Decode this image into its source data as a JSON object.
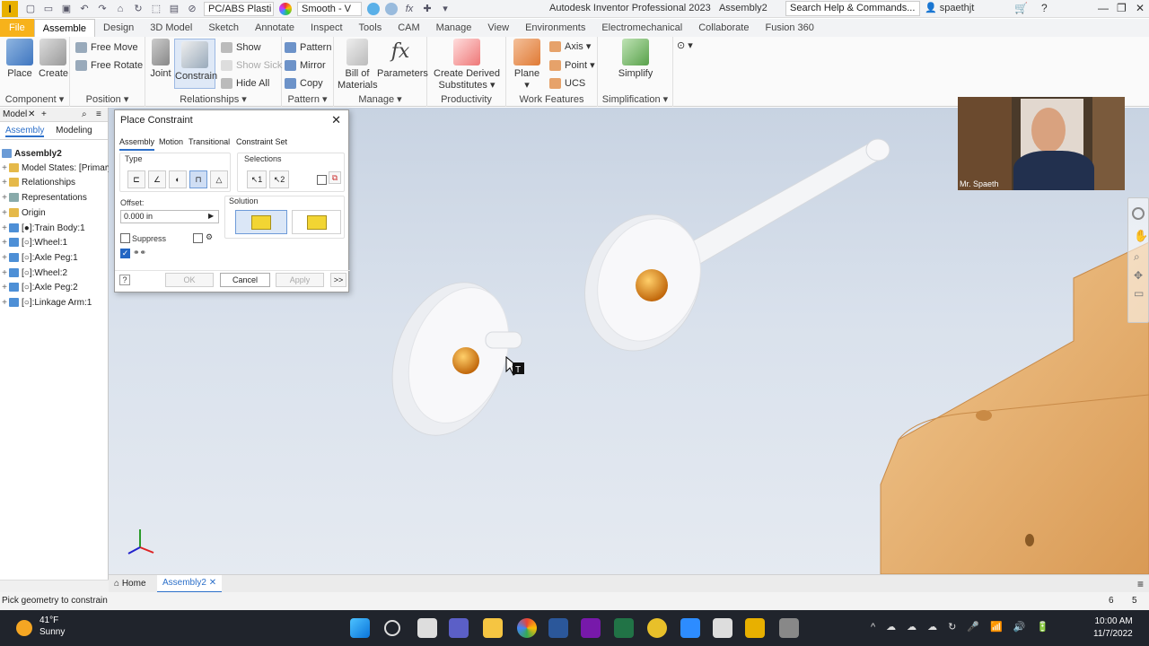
{
  "titlebar": {
    "material": "PC/ABS Plasti",
    "appearance": "Smooth - V",
    "window_title": "Autodesk Inventor Professional 2023",
    "document": "Assembly2",
    "search_placeholder": "Search Help & Commands...",
    "user": "spaethjt"
  },
  "ribbon_tabs": [
    "File",
    "Assemble",
    "Design",
    "3D Model",
    "Sketch",
    "Annotate",
    "Inspect",
    "Tools",
    "CAM",
    "Manage",
    "View",
    "Environments",
    "Electromechanical",
    "Collaborate",
    "Fusion 360"
  ],
  "ribbon": {
    "place": "Place",
    "create": "Create",
    "component": "Component",
    "free_move": "Free Move",
    "free_rotate": "Free Rotate",
    "position": "Position",
    "joint": "Joint",
    "constrain": "Constrain",
    "show": "Show",
    "show_sick": "Show Sick",
    "hide_all": "Hide All",
    "relationships": "Relationships",
    "pattern_btn": "Pattern",
    "mirror": "Mirror",
    "copy": "Copy",
    "pattern": "Pattern",
    "bom_1": "Bill of",
    "bom_2": "Materials",
    "parameters": "Parameters",
    "manage": "Manage",
    "derived_1": "Create Derived",
    "derived_2": "Substitutes",
    "productivity": "Productivity",
    "plane": "Plane",
    "axis": "Axis",
    "point": "Point",
    "ucs": "UCS",
    "work_features": "Work Features",
    "simplify": "Simplify",
    "simplification": "Simplification"
  },
  "browser": {
    "title": "Model",
    "tab_assembly": "Assembly",
    "tab_modeling": "Modeling",
    "root": "Assembly2",
    "items": [
      "Model States: [Primary]",
      "Relationships",
      "Representations",
      "Origin",
      "[●]:Train Body:1",
      "[○]:Wheel:1",
      "[○]:Axle Peg:1",
      "[○]:Wheel:2",
      "[○]:Axle Peg:2",
      "[○]:Linkage Arm:1"
    ]
  },
  "dialog": {
    "title": "Place Constraint",
    "tabs": [
      "Assembly",
      "Motion",
      "Transitional",
      "Constraint Set"
    ],
    "type_label": "Type",
    "selections_label": "Selections",
    "offset_label": "Offset:",
    "offset_value": "0.000 in",
    "solution_label": "Solution",
    "suppress_label": "Suppress",
    "ok": "OK",
    "cancel": "Cancel",
    "apply": "Apply",
    "more": ">>"
  },
  "webcam": {
    "name": "Mr. Spaeth"
  },
  "doctabs": {
    "home": "Home",
    "doc": "Assembly2"
  },
  "status": {
    "text": "Pick geometry to constrain",
    "n1": "6",
    "n2": "5"
  },
  "taskbar": {
    "temp": "41°F",
    "weather": "Sunny",
    "time": "10:00 AM",
    "date": "11/7/2022"
  },
  "colors": {
    "accent": "#2b6fc9",
    "file_tab": "#f7b21b",
    "wood": "#e8b478",
    "axle_orange": "#d9870f"
  }
}
